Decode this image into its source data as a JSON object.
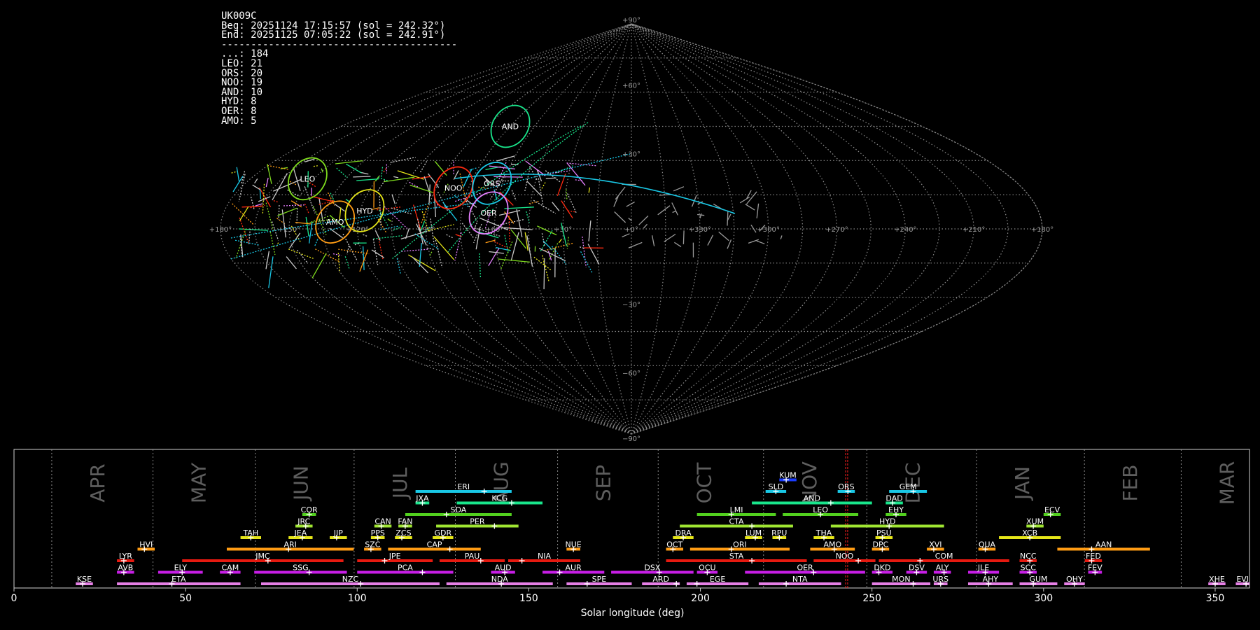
{
  "header": {
    "station": "UK009C",
    "begin": "Beg: 20251124 17:15:57 (sol = 242.32°)",
    "end": "End: 20251125 07:05:22 (sol = 242.91°)",
    "separator": "----------------------------------------",
    "counts": [
      {
        "code": "...",
        "count": 184
      },
      {
        "code": "LEO",
        "count": 21
      },
      {
        "code": "ORS",
        "count": 20
      },
      {
        "code": "NOO",
        "count": 19
      },
      {
        "code": "AND",
        "count": 10
      },
      {
        "code": "HYD",
        "count": 8
      },
      {
        "code": "OER",
        "count": 8
      },
      {
        "code": "AMO",
        "count": 5
      }
    ]
  },
  "chart_data": [
    {
      "type": "scatter",
      "projection": "sinusoidal",
      "lon_ticks": [
        "+180°",
        "+150°",
        "+120°",
        "+90°",
        "+60°",
        "+30°",
        "+0°",
        "+330°",
        "+300°",
        "+270°",
        "+240°",
        "+210°",
        "+180°"
      ],
      "lat_ticks": [
        "+90°",
        "+60°",
        "+30°",
        "−30°",
        "−60°",
        "−90°"
      ],
      "showers": [
        {
          "code": "LEO",
          "lon": 153,
          "lat": 22,
          "color": "#7fdc1e"
        },
        {
          "code": "NOO",
          "lon": 82,
          "lat": 18,
          "color": "#ff2a10"
        },
        {
          "code": "ORS",
          "lon": 65,
          "lat": 20,
          "color": "#19c8e6"
        },
        {
          "code": "AND",
          "lon": 75,
          "lat": 45,
          "color": "#19e68c"
        },
        {
          "code": "HYD",
          "lon": 118,
          "lat": 8,
          "color": "#e6e619"
        },
        {
          "code": "AMO",
          "lon": 130,
          "lat": 3,
          "color": "#ff9c14"
        },
        {
          "code": "OER",
          "lon": 63,
          "lat": 7,
          "color": "#e680ff"
        }
      ]
    },
    {
      "type": "bar",
      "xlabel": "Solar longitude (deg)",
      "xlim": [
        0,
        360
      ],
      "x_ticks": [
        0,
        50,
        100,
        150,
        200,
        250,
        300,
        350
      ],
      "solar_longitude_marker": [
        242.32,
        242.91
      ],
      "months": [
        {
          "label": "APR",
          "start": 11
        },
        {
          "label": "MAY",
          "start": 40.5
        },
        {
          "label": "JUN",
          "start": 70.3
        },
        {
          "label": "JUL",
          "start": 99.1
        },
        {
          "label": "AUG",
          "start": 128.6
        },
        {
          "label": "SEP",
          "start": 158.4
        },
        {
          "label": "OCT",
          "start": 187.7
        },
        {
          "label": "NOV",
          "start": 218.4
        },
        {
          "label": "DEC",
          "start": 248.5
        },
        {
          "label": "JAN",
          "start": 280.5
        },
        {
          "label": "FEB",
          "start": 311.9
        },
        {
          "label": "MAR",
          "start": 340.1
        }
      ],
      "showers": [
        {
          "code": "KUM",
          "start": 223,
          "end": 228,
          "peak": 225,
          "row": 9,
          "color": "#1a3cff"
        },
        {
          "code": "ERI",
          "start": 117,
          "end": 145,
          "peak": 137,
          "row": 8,
          "color": "#19c8e6"
        },
        {
          "code": "SLD",
          "start": 219,
          "end": 225,
          "peak": 222,
          "row": 8,
          "color": "#19c8e6"
        },
        {
          "code": "ORS",
          "start": 240,
          "end": 245,
          "peak": 243,
          "row": 8,
          "color": "#19c8e6"
        },
        {
          "code": "GEM",
          "start": 255,
          "end": 266,
          "peak": 262,
          "row": 8,
          "color": "#19c8e6"
        },
        {
          "code": "JXA",
          "start": 117,
          "end": 121,
          "peak": 119,
          "row": 7,
          "color": "#19e68c"
        },
        {
          "code": "KCG",
          "start": 129,
          "end": 154,
          "peak": 145,
          "row": 7,
          "color": "#19e68c"
        },
        {
          "code": "AND",
          "start": 215,
          "end": 250,
          "peak": 238,
          "row": 7,
          "color": "#19e68c"
        },
        {
          "code": "DAD",
          "start": 254,
          "end": 259,
          "peak": 256,
          "row": 7,
          "color": "#19e68c"
        },
        {
          "code": "COR",
          "start": 84,
          "end": 88,
          "peak": 86,
          "row": 6,
          "color": "#52d01e"
        },
        {
          "code": "SDA",
          "start": 114,
          "end": 145,
          "peak": 126,
          "row": 6,
          "color": "#52d01e"
        },
        {
          "code": "LMI",
          "start": 199,
          "end": 222,
          "peak": 209,
          "row": 6,
          "color": "#52d01e"
        },
        {
          "code": "LEO",
          "start": 224,
          "end": 246,
          "peak": 235,
          "row": 6,
          "color": "#52d01e"
        },
        {
          "code": "EHY",
          "start": 254,
          "end": 260,
          "peak": 257,
          "row": 6,
          "color": "#52d01e"
        },
        {
          "code": "ECV",
          "start": 300,
          "end": 305,
          "peak": 302,
          "row": 6,
          "color": "#52d01e"
        },
        {
          "code": "JRC",
          "start": 82,
          "end": 87,
          "peak": 85,
          "row": 5,
          "color": "#a0e632"
        },
        {
          "code": "CAN",
          "start": 105,
          "end": 110,
          "peak": 107,
          "row": 5,
          "color": "#a0e632"
        },
        {
          "code": "FAN",
          "start": 112,
          "end": 116,
          "peak": 114,
          "row": 5,
          "color": "#a0e632"
        },
        {
          "code": "PER",
          "start": 123,
          "end": 147,
          "peak": 140,
          "row": 5,
          "color": "#a0e632"
        },
        {
          "code": "CTA",
          "start": 194,
          "end": 227,
          "peak": 215,
          "row": 5,
          "color": "#a0e632"
        },
        {
          "code": "HYD",
          "start": 238,
          "end": 271,
          "peak": 255,
          "row": 5,
          "color": "#a0e632"
        },
        {
          "code": "XUM",
          "start": 295,
          "end": 300,
          "peak": 297,
          "row": 5,
          "color": "#a0e632"
        },
        {
          "code": "TAH",
          "start": 66,
          "end": 72,
          "peak": 69,
          "row": 4,
          "color": "#e6e619"
        },
        {
          "code": "JEA",
          "start": 80,
          "end": 87,
          "peak": 84,
          "row": 4,
          "color": "#e6e619"
        },
        {
          "code": "JIP",
          "start": 92,
          "end": 97,
          "peak": 94,
          "row": 4,
          "color": "#e6e619"
        },
        {
          "code": "PPS",
          "start": 104,
          "end": 108,
          "peak": 106,
          "row": 4,
          "color": "#e6e619"
        },
        {
          "code": "ZCS",
          "start": 111,
          "end": 116,
          "peak": 113,
          "row": 4,
          "color": "#e6e619"
        },
        {
          "code": "GDR",
          "start": 122,
          "end": 128,
          "peak": 125,
          "row": 4,
          "color": "#e6e619"
        },
        {
          "code": "DRA",
          "start": 192,
          "end": 198,
          "peak": 195,
          "row": 4,
          "color": "#e6e619"
        },
        {
          "code": "LUM",
          "start": 213,
          "end": 218,
          "peak": 216,
          "row": 4,
          "color": "#e6e619"
        },
        {
          "code": "RPU",
          "start": 221,
          "end": 225,
          "peak": 223,
          "row": 4,
          "color": "#e6e619"
        },
        {
          "code": "THA",
          "start": 233,
          "end": 239,
          "peak": 236,
          "row": 4,
          "color": "#e6e619"
        },
        {
          "code": "PSU",
          "start": 251,
          "end": 256,
          "peak": 253,
          "row": 4,
          "color": "#e6e619"
        },
        {
          "code": "XCB",
          "start": 287,
          "end": 305,
          "peak": 296,
          "row": 4,
          "color": "#e6e619"
        },
        {
          "code": "HVI",
          "start": 36,
          "end": 41,
          "peak": 38,
          "row": 3,
          "color": "#ff9c14"
        },
        {
          "code": "ARI",
          "start": 62,
          "end": 99,
          "peak": 80,
          "row": 3,
          "color": "#ff9c14"
        },
        {
          "code": "SZC",
          "start": 102,
          "end": 107,
          "peak": 104,
          "row": 3,
          "color": "#ff9c14"
        },
        {
          "code": "CAP",
          "start": 109,
          "end": 136,
          "peak": 127,
          "row": 3,
          "color": "#ff9c14"
        },
        {
          "code": "NUE",
          "start": 161,
          "end": 165,
          "peak": 163,
          "row": 3,
          "color": "#ff9c14"
        },
        {
          "code": "OCT",
          "start": 190,
          "end": 195,
          "peak": 192,
          "row": 3,
          "color": "#ff9c14"
        },
        {
          "code": "ORI",
          "start": 197,
          "end": 226,
          "peak": 209,
          "row": 3,
          "color": "#ff9c14"
        },
        {
          "code": "AMO",
          "start": 232,
          "end": 245,
          "peak": 239,
          "row": 3,
          "color": "#ff9c14"
        },
        {
          "code": "DPC",
          "start": 250,
          "end": 255,
          "peak": 253,
          "row": 3,
          "color": "#ff9c14"
        },
        {
          "code": "XVI",
          "start": 266,
          "end": 271,
          "peak": 268,
          "row": 3,
          "color": "#ff9c14"
        },
        {
          "code": "QUA",
          "start": 281,
          "end": 286,
          "peak": 283,
          "row": 3,
          "color": "#ff9c14"
        },
        {
          "code": "AAN",
          "start": 304,
          "end": 331,
          "peak": 314,
          "row": 3,
          "color": "#ff9c14"
        },
        {
          "code": "LYR",
          "start": 30,
          "end": 35,
          "peak": 32,
          "row": 2,
          "color": "#e61a10"
        },
        {
          "code": "JMC",
          "start": 49,
          "end": 96,
          "peak": 74,
          "row": 2,
          "color": "#e61a10"
        },
        {
          "code": "JPE",
          "start": 100,
          "end": 122,
          "peak": 108,
          "row": 2,
          "color": "#e61a10"
        },
        {
          "code": "PAU",
          "start": 124,
          "end": 143,
          "peak": 136,
          "row": 2,
          "color": "#e61a10"
        },
        {
          "code": "NIA",
          "start": 144,
          "end": 165,
          "peak": 148,
          "row": 2,
          "color": "#e61a10"
        },
        {
          "code": "STA",
          "start": 190,
          "end": 231,
          "peak": 215,
          "row": 2,
          "color": "#e61a10"
        },
        {
          "code": "NOO",
          "start": 233,
          "end": 251,
          "peak": 246,
          "row": 2,
          "color": "#e61a10"
        },
        {
          "code": "COM",
          "start": 252,
          "end": 290,
          "peak": 264,
          "row": 2,
          "color": "#e61a10"
        },
        {
          "code": "NCC",
          "start": 293,
          "end": 298,
          "peak": 296,
          "row": 2,
          "color": "#e61a10"
        },
        {
          "code": "FED",
          "start": 312,
          "end": 317,
          "peak": 314,
          "row": 2,
          "color": "#e61a10"
        },
        {
          "code": "AVB",
          "start": 30,
          "end": 35,
          "peak": 32,
          "row": 1,
          "color": "#c81ee6"
        },
        {
          "code": "ELY",
          "start": 42,
          "end": 55,
          "peak": 49,
          "row": 1,
          "color": "#c81ee6"
        },
        {
          "code": "CAM",
          "start": 60,
          "end": 66,
          "peak": 63,
          "row": 1,
          "color": "#c81ee6"
        },
        {
          "code": "SSG",
          "start": 70,
          "end": 97,
          "peak": 86,
          "row": 1,
          "color": "#c81ee6"
        },
        {
          "code": "PCA",
          "start": 100,
          "end": 128,
          "peak": 119,
          "row": 1,
          "color": "#c81ee6"
        },
        {
          "code": "AUD",
          "start": 139,
          "end": 146,
          "peak": 143,
          "row": 1,
          "color": "#c81ee6"
        },
        {
          "code": "AUR",
          "start": 154,
          "end": 172,
          "peak": 159,
          "row": 1,
          "color": "#c81ee6"
        },
        {
          "code": "DSX",
          "start": 174,
          "end": 198,
          "peak": 188,
          "row": 1,
          "color": "#c81ee6"
        },
        {
          "code": "OCU",
          "start": 199,
          "end": 205,
          "peak": 202,
          "row": 1,
          "color": "#c81ee6"
        },
        {
          "code": "OER",
          "start": 213,
          "end": 248,
          "peak": 233,
          "row": 1,
          "color": "#c81ee6"
        },
        {
          "code": "DKD",
          "start": 250,
          "end": 256,
          "peak": 252,
          "row": 1,
          "color": "#c81ee6"
        },
        {
          "code": "DSV",
          "start": 260,
          "end": 266,
          "peak": 263,
          "row": 1,
          "color": "#c81ee6"
        },
        {
          "code": "ALY",
          "start": 268,
          "end": 273,
          "peak": 271,
          "row": 1,
          "color": "#c81ee6"
        },
        {
          "code": "JLE",
          "start": 278,
          "end": 287,
          "peak": 283,
          "row": 1,
          "color": "#c81ee6"
        },
        {
          "code": "SCC",
          "start": 293,
          "end": 298,
          "peak": 296,
          "row": 1,
          "color": "#c81ee6"
        },
        {
          "code": "FEV",
          "start": 313,
          "end": 317,
          "peak": 315,
          "row": 1,
          "color": "#c81ee6"
        },
        {
          "code": "KSE",
          "start": 18,
          "end": 23,
          "peak": 20,
          "row": 0,
          "color": "#e680e6"
        },
        {
          "code": "ETA",
          "start": 30,
          "end": 66,
          "peak": 46,
          "row": 0,
          "color": "#e680e6"
        },
        {
          "code": "NZC",
          "start": 72,
          "end": 124,
          "peak": 101,
          "row": 0,
          "color": "#e680e6"
        },
        {
          "code": "NDA",
          "start": 126,
          "end": 157,
          "peak": 142,
          "row": 0,
          "color": "#e680e6"
        },
        {
          "code": "SPE",
          "start": 161,
          "end": 180,
          "peak": 167,
          "row": 0,
          "color": "#e680e6"
        },
        {
          "code": "ARD",
          "start": 183,
          "end": 194,
          "peak": 193,
          "row": 0,
          "color": "#e680e6"
        },
        {
          "code": "EGE",
          "start": 196,
          "end": 214,
          "peak": 199,
          "row": 0,
          "color": "#e680e6"
        },
        {
          "code": "NTA",
          "start": 217,
          "end": 241,
          "peak": 225,
          "row": 0,
          "color": "#e680e6"
        },
        {
          "code": "MON",
          "start": 250,
          "end": 267,
          "peak": 262,
          "row": 0,
          "color": "#e680e6"
        },
        {
          "code": "URS",
          "start": 268,
          "end": 272,
          "peak": 270,
          "row": 0,
          "color": "#e680e6"
        },
        {
          "code": "AHY",
          "start": 278,
          "end": 291,
          "peak": 284,
          "row": 0,
          "color": "#e680e6"
        },
        {
          "code": "GUM",
          "start": 293,
          "end": 304,
          "peak": 297,
          "row": 0,
          "color": "#e680e6"
        },
        {
          "code": "OHY",
          "start": 306,
          "end": 312,
          "peak": 309,
          "row": 0,
          "color": "#e680e6"
        },
        {
          "code": "XHE",
          "start": 348,
          "end": 353,
          "peak": 350,
          "row": 0,
          "color": "#e680e6"
        },
        {
          "code": "EVI",
          "start": 356,
          "end": 361,
          "peak": 359,
          "row": 0,
          "color": "#e680e6"
        }
      ]
    }
  ]
}
